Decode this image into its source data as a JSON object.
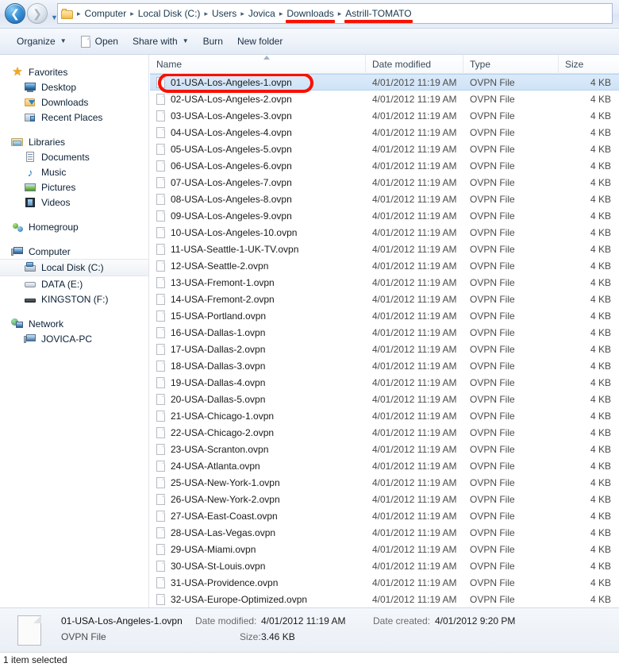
{
  "address_bar": {
    "back_icon": "back-arrow-icon",
    "forward_icon": "forward-arrow-icon",
    "history_caret": "▼",
    "folder_icon": "folder-icon",
    "separator": "▸",
    "crumbs": [
      {
        "label": "Computer",
        "underlined": false
      },
      {
        "label": "Local Disk (C:)",
        "underlined": false
      },
      {
        "label": "Users",
        "underlined": false
      },
      {
        "label": "Jovica",
        "underlined": false
      },
      {
        "label": "Downloads",
        "underlined": true
      },
      {
        "label": "Astrill-TOMATO",
        "underlined": true
      }
    ],
    "annotation_color": "#f81100"
  },
  "toolbar": {
    "items": [
      {
        "label": "Organize",
        "caret": "▼",
        "icon": ""
      },
      {
        "label": "Open",
        "caret": "",
        "icon": "page-icon"
      },
      {
        "label": "Share with",
        "caret": "▼",
        "icon": ""
      },
      {
        "label": "Burn",
        "caret": "",
        "icon": ""
      },
      {
        "label": "New folder",
        "caret": "",
        "icon": ""
      }
    ]
  },
  "sidebar": {
    "groups": [
      {
        "header": {
          "label": "Favorites",
          "icon": "star-icon"
        },
        "items": [
          {
            "label": "Desktop",
            "icon": "desktop-icon",
            "selected": false
          },
          {
            "label": "Downloads",
            "icon": "downloads-folder-icon",
            "selected": false
          },
          {
            "label": "Recent Places",
            "icon": "recent-places-icon",
            "selected": false
          }
        ]
      },
      {
        "header": {
          "label": "Libraries",
          "icon": "libraries-icon"
        },
        "items": [
          {
            "label": "Documents",
            "icon": "documents-icon",
            "selected": false
          },
          {
            "label": "Music",
            "icon": "music-note-icon",
            "selected": false
          },
          {
            "label": "Pictures",
            "icon": "pictures-icon",
            "selected": false
          },
          {
            "label": "Videos",
            "icon": "videos-filmstrip-icon",
            "selected": false
          }
        ]
      },
      {
        "header": {
          "label": "Homegroup",
          "icon": "homegroup-icon"
        },
        "items": []
      },
      {
        "header": {
          "label": "Computer",
          "icon": "computer-icon"
        },
        "items": [
          {
            "label": "Local Disk (C:)",
            "icon": "system-drive-icon",
            "selected": true
          },
          {
            "label": "DATA (E:)",
            "icon": "hard-drive-icon",
            "selected": false
          },
          {
            "label": "KINGSTON (F:)",
            "icon": "usb-drive-icon",
            "selected": false
          }
        ]
      },
      {
        "header": {
          "label": "Network",
          "icon": "network-icon"
        },
        "items": [
          {
            "label": "JOVICA-PC",
            "icon": "network-computer-icon",
            "selected": false
          }
        ]
      }
    ]
  },
  "file_list": {
    "columns": [
      {
        "key": "name",
        "label": "Name",
        "sorted": true,
        "sort_direction": "ascending"
      },
      {
        "key": "date",
        "label": "Date modified",
        "sorted": false
      },
      {
        "key": "type",
        "label": "Type",
        "sorted": false
      },
      {
        "key": "size",
        "label": "Size",
        "sorted": false
      }
    ],
    "rows": [
      {
        "name": "01-USA-Los-Angeles-1.ovpn",
        "date": "4/01/2012 11:19 AM",
        "type": "OVPN File",
        "size": "4 KB",
        "selected": true,
        "annotated": true
      },
      {
        "name": "02-USA-Los-Angeles-2.ovpn",
        "date": "4/01/2012 11:19 AM",
        "type": "OVPN File",
        "size": "4 KB",
        "selected": false,
        "annotated": false
      },
      {
        "name": "03-USA-Los-Angeles-3.ovpn",
        "date": "4/01/2012 11:19 AM",
        "type": "OVPN File",
        "size": "4 KB",
        "selected": false,
        "annotated": false
      },
      {
        "name": "04-USA-Los-Angeles-4.ovpn",
        "date": "4/01/2012 11:19 AM",
        "type": "OVPN File",
        "size": "4 KB",
        "selected": false,
        "annotated": false
      },
      {
        "name": "05-USA-Los-Angeles-5.ovpn",
        "date": "4/01/2012 11:19 AM",
        "type": "OVPN File",
        "size": "4 KB",
        "selected": false,
        "annotated": false
      },
      {
        "name": "06-USA-Los-Angeles-6.ovpn",
        "date": "4/01/2012 11:19 AM",
        "type": "OVPN File",
        "size": "4 KB",
        "selected": false,
        "annotated": false
      },
      {
        "name": "07-USA-Los-Angeles-7.ovpn",
        "date": "4/01/2012 11:19 AM",
        "type": "OVPN File",
        "size": "4 KB",
        "selected": false,
        "annotated": false
      },
      {
        "name": "08-USA-Los-Angeles-8.ovpn",
        "date": "4/01/2012 11:19 AM",
        "type": "OVPN File",
        "size": "4 KB",
        "selected": false,
        "annotated": false
      },
      {
        "name": "09-USA-Los-Angeles-9.ovpn",
        "date": "4/01/2012 11:19 AM",
        "type": "OVPN File",
        "size": "4 KB",
        "selected": false,
        "annotated": false
      },
      {
        "name": "10-USA-Los-Angeles-10.ovpn",
        "date": "4/01/2012 11:19 AM",
        "type": "OVPN File",
        "size": "4 KB",
        "selected": false,
        "annotated": false
      },
      {
        "name": "11-USA-Seattle-1-UK-TV.ovpn",
        "date": "4/01/2012 11:19 AM",
        "type": "OVPN File",
        "size": "4 KB",
        "selected": false,
        "annotated": false
      },
      {
        "name": "12-USA-Seattle-2.ovpn",
        "date": "4/01/2012 11:19 AM",
        "type": "OVPN File",
        "size": "4 KB",
        "selected": false,
        "annotated": false
      },
      {
        "name": "13-USA-Fremont-1.ovpn",
        "date": "4/01/2012 11:19 AM",
        "type": "OVPN File",
        "size": "4 KB",
        "selected": false,
        "annotated": false
      },
      {
        "name": "14-USA-Fremont-2.ovpn",
        "date": "4/01/2012 11:19 AM",
        "type": "OVPN File",
        "size": "4 KB",
        "selected": false,
        "annotated": false
      },
      {
        "name": "15-USA-Portland.ovpn",
        "date": "4/01/2012 11:19 AM",
        "type": "OVPN File",
        "size": "4 KB",
        "selected": false,
        "annotated": false
      },
      {
        "name": "16-USA-Dallas-1.ovpn",
        "date": "4/01/2012 11:19 AM",
        "type": "OVPN File",
        "size": "4 KB",
        "selected": false,
        "annotated": false
      },
      {
        "name": "17-USA-Dallas-2.ovpn",
        "date": "4/01/2012 11:19 AM",
        "type": "OVPN File",
        "size": "4 KB",
        "selected": false,
        "annotated": false
      },
      {
        "name": "18-USA-Dallas-3.ovpn",
        "date": "4/01/2012 11:19 AM",
        "type": "OVPN File",
        "size": "4 KB",
        "selected": false,
        "annotated": false
      },
      {
        "name": "19-USA-Dallas-4.ovpn",
        "date": "4/01/2012 11:19 AM",
        "type": "OVPN File",
        "size": "4 KB",
        "selected": false,
        "annotated": false
      },
      {
        "name": "20-USA-Dallas-5.ovpn",
        "date": "4/01/2012 11:19 AM",
        "type": "OVPN File",
        "size": "4 KB",
        "selected": false,
        "annotated": false
      },
      {
        "name": "21-USA-Chicago-1.ovpn",
        "date": "4/01/2012 11:19 AM",
        "type": "OVPN File",
        "size": "4 KB",
        "selected": false,
        "annotated": false
      },
      {
        "name": "22-USA-Chicago-2.ovpn",
        "date": "4/01/2012 11:19 AM",
        "type": "OVPN File",
        "size": "4 KB",
        "selected": false,
        "annotated": false
      },
      {
        "name": "23-USA-Scranton.ovpn",
        "date": "4/01/2012 11:19 AM",
        "type": "OVPN File",
        "size": "4 KB",
        "selected": false,
        "annotated": false
      },
      {
        "name": "24-USA-Atlanta.ovpn",
        "date": "4/01/2012 11:19 AM",
        "type": "OVPN File",
        "size": "4 KB",
        "selected": false,
        "annotated": false
      },
      {
        "name": "25-USA-New-York-1.ovpn",
        "date": "4/01/2012 11:19 AM",
        "type": "OVPN File",
        "size": "4 KB",
        "selected": false,
        "annotated": false
      },
      {
        "name": "26-USA-New-York-2.ovpn",
        "date": "4/01/2012 11:19 AM",
        "type": "OVPN File",
        "size": "4 KB",
        "selected": false,
        "annotated": false
      },
      {
        "name": "27-USA-East-Coast.ovpn",
        "date": "4/01/2012 11:19 AM",
        "type": "OVPN File",
        "size": "4 KB",
        "selected": false,
        "annotated": false
      },
      {
        "name": "28-USA-Las-Vegas.ovpn",
        "date": "4/01/2012 11:19 AM",
        "type": "OVPN File",
        "size": "4 KB",
        "selected": false,
        "annotated": false
      },
      {
        "name": "29-USA-Miami.ovpn",
        "date": "4/01/2012 11:19 AM",
        "type": "OVPN File",
        "size": "4 KB",
        "selected": false,
        "annotated": false
      },
      {
        "name": "30-USA-St-Louis.ovpn",
        "date": "4/01/2012 11:19 AM",
        "type": "OVPN File",
        "size": "4 KB",
        "selected": false,
        "annotated": false
      },
      {
        "name": "31-USA-Providence.ovpn",
        "date": "4/01/2012 11:19 AM",
        "type": "OVPN File",
        "size": "4 KB",
        "selected": false,
        "annotated": false
      },
      {
        "name": "32-USA-Europe-Optimized.ovpn",
        "date": "4/01/2012 11:19 AM",
        "type": "OVPN File",
        "size": "4 KB",
        "selected": false,
        "annotated": false
      }
    ]
  },
  "details_pane": {
    "file_icon": "file-icon",
    "file_name": "01-USA-Los-Angeles-1.ovpn",
    "file_type": "OVPN File",
    "date_modified_label": "Date modified:",
    "date_modified_value": "4/01/2012 11:19 AM",
    "size_label": "Size:",
    "size_value": "3.46 KB",
    "date_created_label": "Date created:",
    "date_created_value": "4/01/2012 9:20 PM"
  },
  "status_bar": {
    "text": "1 item selected"
  }
}
